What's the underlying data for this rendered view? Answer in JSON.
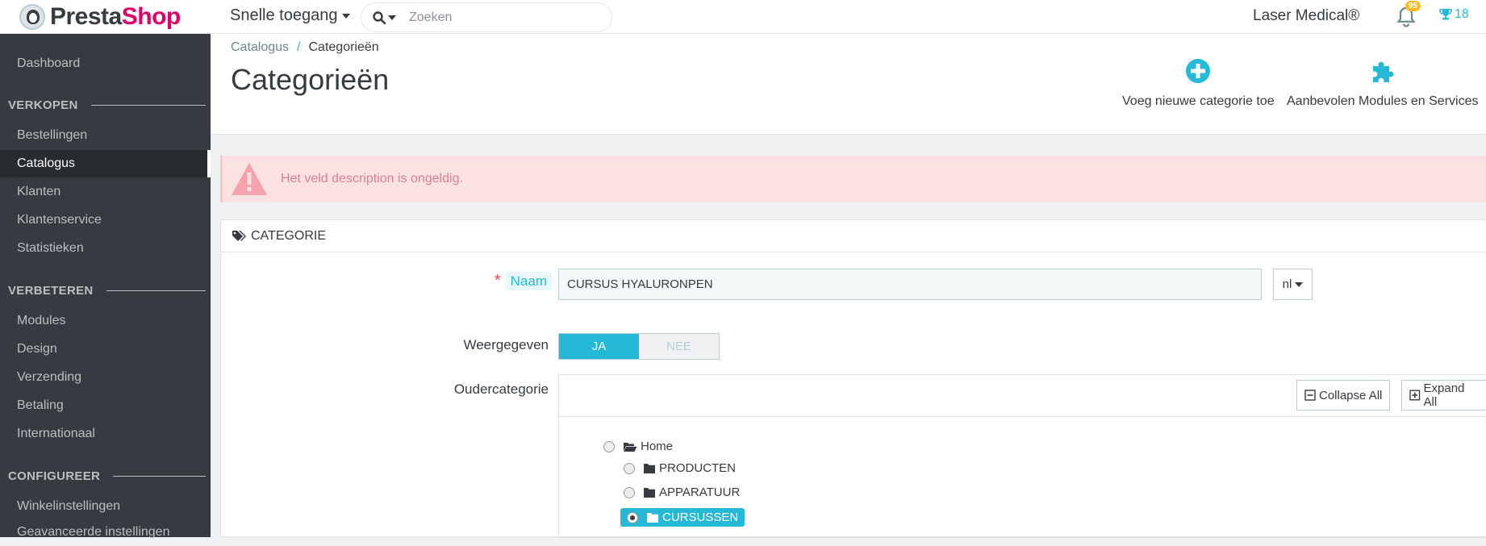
{
  "header": {
    "logo_part1": "Presta",
    "logo_part2": "Shop",
    "quick_access": "Snelle toegang",
    "search_placeholder": "Zoeken",
    "shop_name": "Laser Medical®",
    "notifications_count": "95",
    "trophy_count": "18"
  },
  "sidebar": {
    "dashboard": "Dashboard",
    "section_sell": "VERKOPEN",
    "orders": "Bestellingen",
    "catalog": "Catalogus",
    "customers": "Klanten",
    "customer_service": "Klantenservice",
    "stats": "Statistieken",
    "section_improve": "VERBETEREN",
    "modules": "Modules",
    "design": "Design",
    "shipping": "Verzending",
    "payment": "Betaling",
    "international": "Internationaal",
    "section_configure": "CONFIGUREER",
    "shop_params": "Winkelinstellingen",
    "advanced_params": "Geavanceerde instellingen"
  },
  "page": {
    "breadcrumb_root": "Catalogus",
    "breadcrumb_sep": "/",
    "breadcrumb_current": "Categorieën",
    "title": "Categorieën",
    "add_category": "Voeg nieuwe categorie toe",
    "recommended_modules": "Aanbevolen Modules en Services"
  },
  "alert": {
    "message": "Het veld description is ongeldig."
  },
  "form": {
    "panel_title": "CATEGORIE",
    "required_mark": "*",
    "name_label": "Naam",
    "name_value": "CURSUS HYALURONPEN",
    "language": "nl",
    "displayed_label": "Weergegeven",
    "yes": "JA",
    "no": "NEE",
    "parent_label": "Oudercategorie",
    "collapse_all": "Collapse All",
    "expand_all": "Expand All",
    "tree": {
      "home": "Home",
      "products": "PRODUCTEN",
      "equipment": "APPARATUUR",
      "courses": "CURSUSSEN"
    }
  },
  "colors": {
    "accent": "#25b9d7",
    "sidebar_bg": "#363a41",
    "alert_bg": "#fbe1e1",
    "danger": "#e54847",
    "badge": "#fbbb22"
  }
}
